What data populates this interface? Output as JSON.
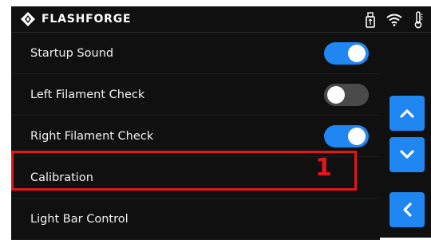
{
  "status_bar": {
    "brand": "FLASHFORGE",
    "icons": [
      "usb-drive-icon",
      "wifi-icon",
      "thermometer-icon"
    ]
  },
  "settings": [
    {
      "label": "Startup Sound",
      "toggle": "on"
    },
    {
      "label": "Left Filament Check",
      "toggle": "off"
    },
    {
      "label": "Right Filament Check",
      "toggle": "on"
    },
    {
      "label": "Calibration"
    },
    {
      "label": "Light Bar Control"
    }
  ],
  "annotation": {
    "marker": "1",
    "color": "#e3161b"
  },
  "side_buttons": [
    "chevron-up-icon",
    "chevron-down-icon",
    "chevron-left-icon"
  ],
  "colors": {
    "accent": "#1f86f2",
    "background": "#101010",
    "toggle_off": "#4a4a4a"
  }
}
